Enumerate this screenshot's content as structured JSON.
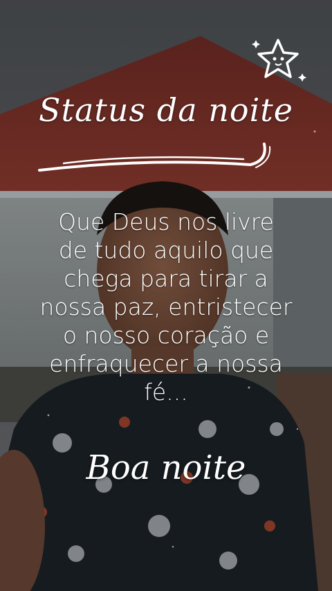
{
  "title": "Status da noite",
  "quote": "Que Deus nos livre\nde tudo aquilo que\nchega para tirar a\nnossa paz, entristecer\no nosso coração e\nenfraquecer a nossa\nfé...",
  "signoff": "Boa noite",
  "colors": {
    "roof": "#7a2e26",
    "sky": "#5a5d61",
    "wall": "#8e9495",
    "shirt": "#1c2128",
    "text": "#ffffff"
  },
  "icons": [
    "star-icon",
    "sparkle-icon"
  ]
}
